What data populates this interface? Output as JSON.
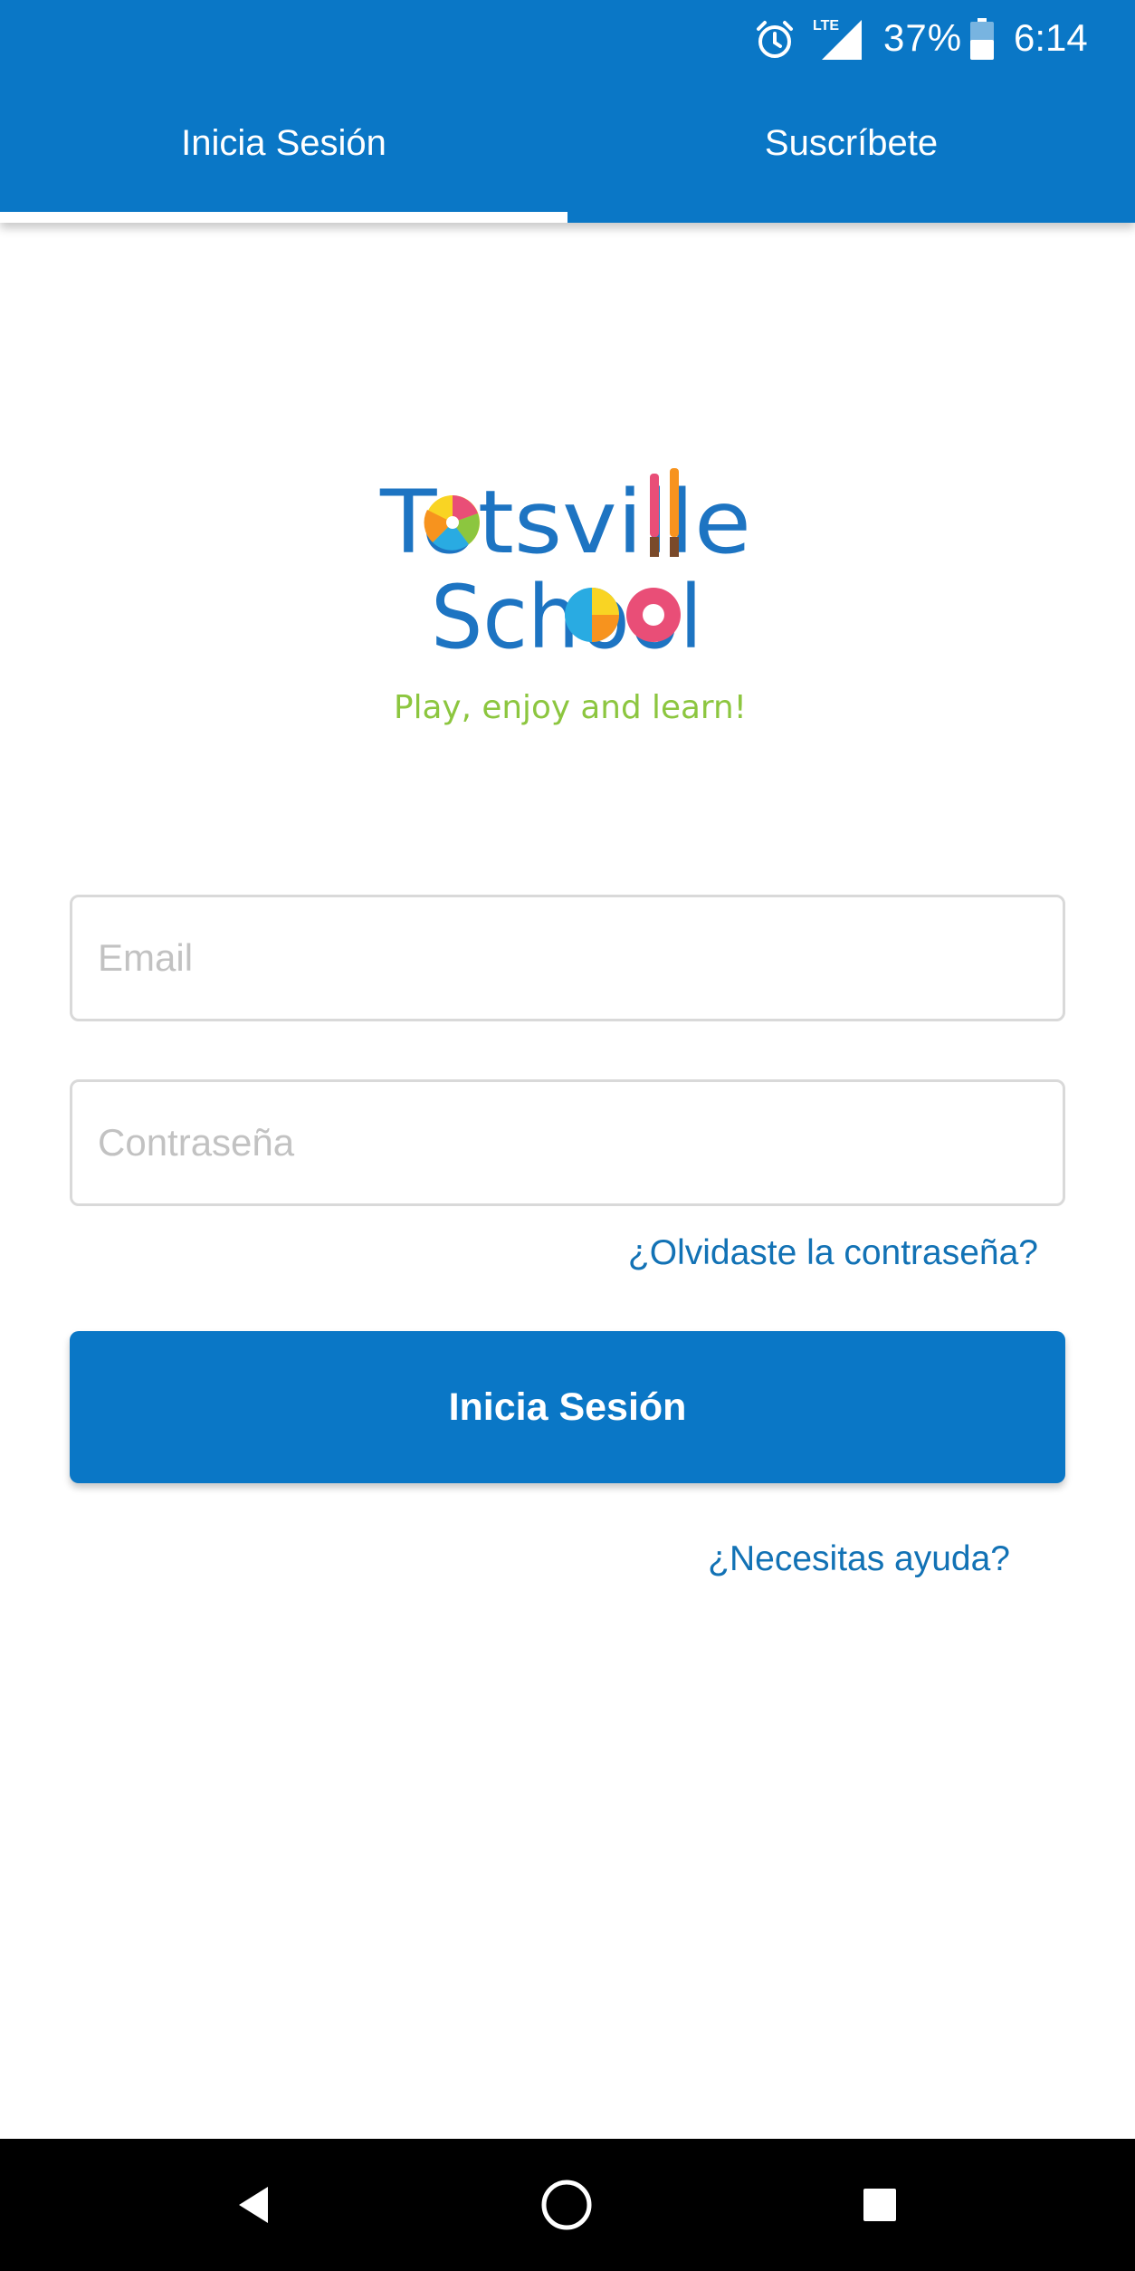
{
  "status_bar": {
    "network_label": "LTE",
    "battery_percent": "37%",
    "time": "6:14",
    "icons": [
      "alarm-icon",
      "lte-signal-icon",
      "battery-icon"
    ]
  },
  "tabs": [
    {
      "label": "Inicia Sesión",
      "selected": true
    },
    {
      "label": "Suscríbete",
      "selected": false
    }
  ],
  "logo": {
    "line1": "Totsville",
    "line2": "School",
    "tagline": "Play, enjoy and learn!"
  },
  "form": {
    "email_placeholder": "Email",
    "password_placeholder": "Contraseña",
    "forgot_password": "¿Olvidaste la contraseña?",
    "submit_label": "Inicia Sesión",
    "help_link": "¿Necesitas ayuda?"
  },
  "nav_bar": {
    "icons": [
      "back-icon",
      "home-icon",
      "recents-icon"
    ]
  },
  "colors": {
    "primary": "#0a77c6",
    "link": "#1272b5",
    "logo_blue": "#1d74c2",
    "tagline_green": "#8cc63f"
  }
}
